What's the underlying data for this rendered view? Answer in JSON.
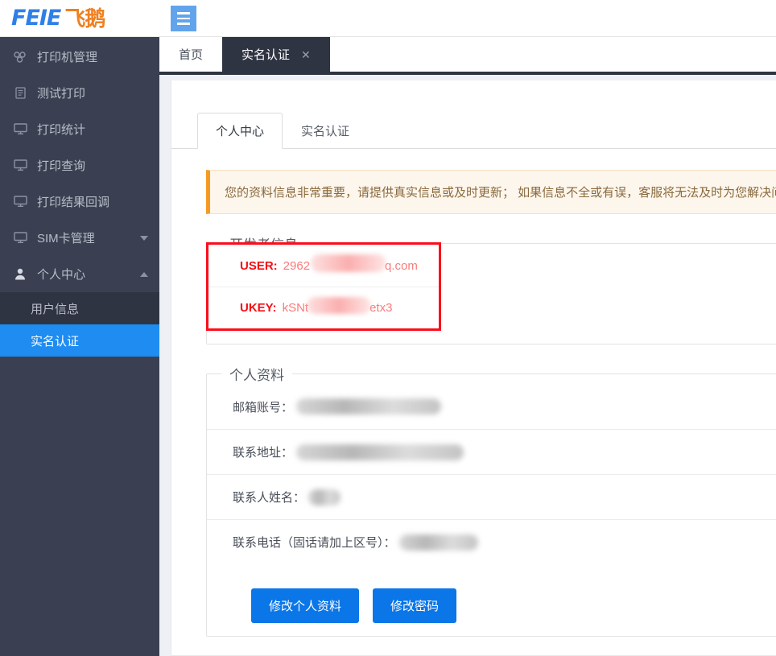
{
  "brand": {
    "name_latin": "FEIE",
    "name_cn": "飞鹅"
  },
  "sidebar": {
    "items": [
      {
        "label": "打印机管理",
        "icon": "sitemap-icon",
        "has_caret": false
      },
      {
        "label": "测试打印",
        "icon": "file-icon",
        "has_caret": false
      },
      {
        "label": "打印统计",
        "icon": "monitor-icon",
        "has_caret": false
      },
      {
        "label": "打印查询",
        "icon": "monitor-icon",
        "has_caret": false
      },
      {
        "label": "打印结果回调",
        "icon": "monitor-icon",
        "has_caret": false
      },
      {
        "label": "SIM卡管理",
        "icon": "monitor-icon",
        "has_caret": true,
        "caret": "down"
      },
      {
        "label": "个人中心",
        "icon": "user-icon",
        "has_caret": true,
        "caret": "up"
      }
    ],
    "subitems": [
      {
        "label": "用户信息",
        "active": false
      },
      {
        "label": "实名认证",
        "active": true
      }
    ]
  },
  "topbar": {
    "menu_toggle": "hamburger-icon"
  },
  "tabs": [
    {
      "label": "首页",
      "active": false,
      "closable": false
    },
    {
      "label": "实名认证",
      "active": true,
      "closable": true,
      "close_glyph": "✕"
    }
  ],
  "inner_tabs": [
    {
      "label": "个人中心",
      "active": true
    },
    {
      "label": "实名认证",
      "active": false
    }
  ],
  "alert": {
    "text": "您的资料信息非常重要，请提供真实信息或及时更新；  如果信息不全或有误，客服将无法及时为您解决问题。"
  },
  "developer_section": {
    "legend": "开发者信息",
    "rows": [
      {
        "key": "USER:",
        "value_prefix": "2962",
        "value_suffix": "q.com",
        "redacted": true
      },
      {
        "key": "UKEY:",
        "value_prefix": "kSNt",
        "value_suffix": "etx3",
        "redacted": true
      }
    ]
  },
  "profile_section": {
    "legend": "个人资料",
    "rows": [
      {
        "label": "邮箱账号：",
        "value": "",
        "redacted": true,
        "blur_width": 180
      },
      {
        "label": "联系地址：",
        "value": "",
        "redacted": true,
        "blur_width": 208
      },
      {
        "label": "联系人姓名：",
        "value": "",
        "redacted": true,
        "blur_width": 40
      },
      {
        "label": "联系电话（固话请加上区号）：",
        "value": "",
        "redacted": true,
        "blur_width": 98
      }
    ]
  },
  "buttons": [
    {
      "label": "修改个人资料",
      "name": "edit-profile-button"
    },
    {
      "label": "修改密码",
      "name": "change-password-button"
    }
  ],
  "colors": {
    "sidebar_bg": "#3a4051",
    "sidebar_sub_bg": "#2f3442",
    "accent_blue": "#1e8cf1",
    "button_blue": "#0a76e8",
    "alert_bg": "#fdf6ec",
    "alert_border": "#f59a23",
    "red_box": "#fc0d1b",
    "brand_blue": "#2f7fe8",
    "brand_orange": "#f08020"
  }
}
